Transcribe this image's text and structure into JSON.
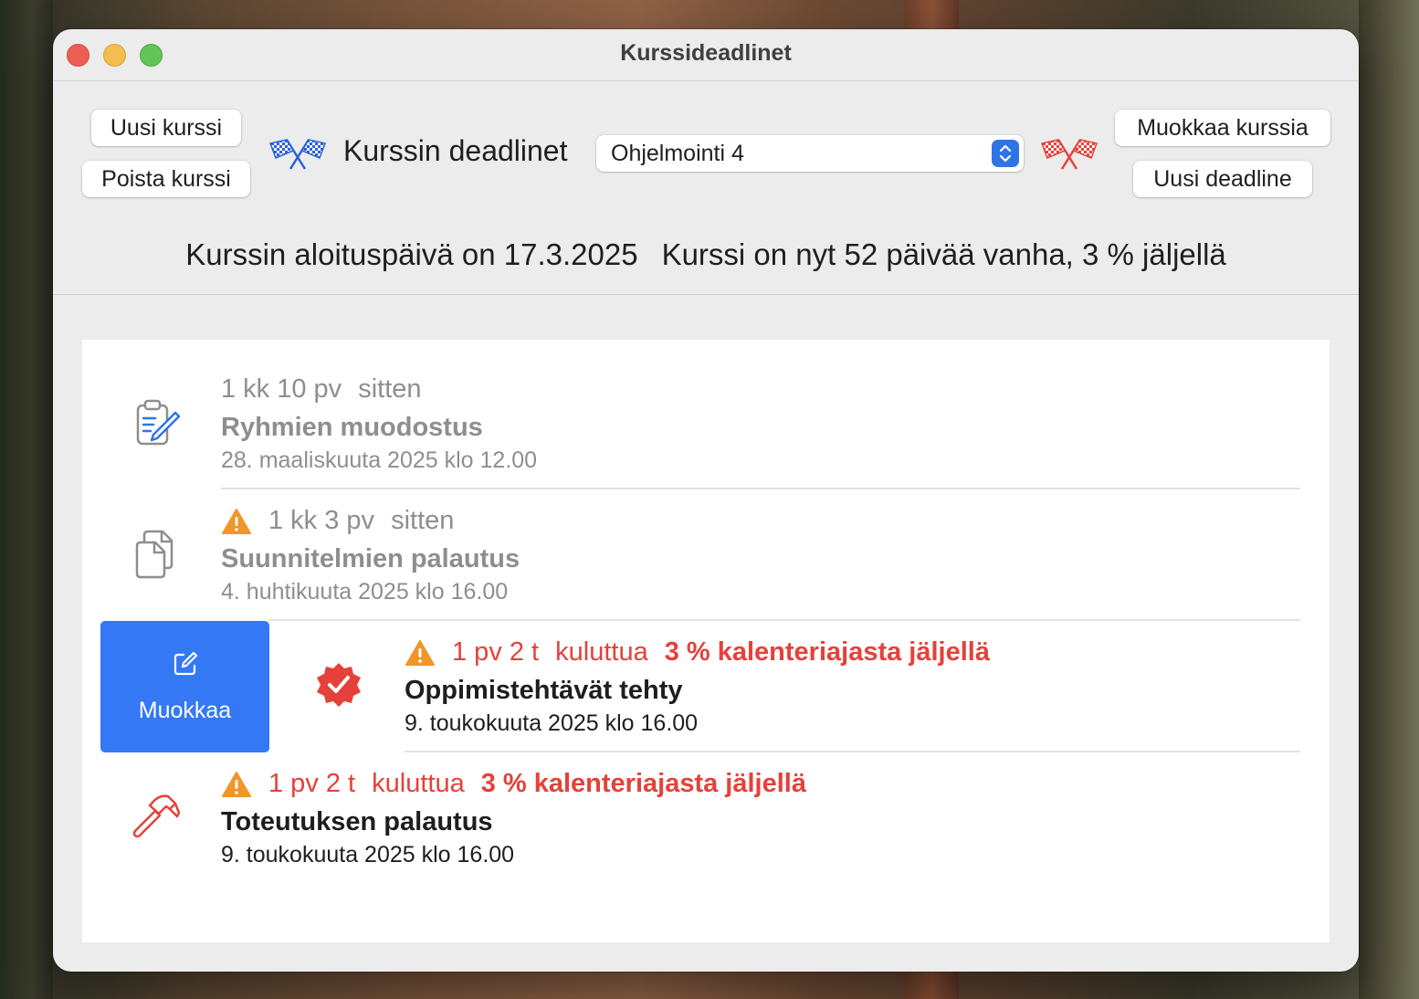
{
  "window": {
    "title": "Kurssideadlinet"
  },
  "toolbar": {
    "new_course": "Uusi kurssi",
    "delete_course": "Poista kurssi",
    "edit_course": "Muokkaa kurssia",
    "new_deadline": "Uusi deadline",
    "heading": "Kurssin deadlinet",
    "course_select": {
      "selected": "Ohjelmointi 4"
    }
  },
  "course_info": {
    "start": "Kurssin aloituspäivä on 17.3.2025",
    "age": "Kurssi on nyt 52 päivää vanha, 3 % jäljellä"
  },
  "deadlines": [
    {
      "icon": "clipboard-edit-icon",
      "when": "1 kk 10 pv",
      "relation": "sitten",
      "remaining": "",
      "title": "Ryhmien muodostus",
      "date": "28. maaliskuuta 2025 klo 12.00",
      "warning": false,
      "state": "past"
    },
    {
      "icon": "documents-icon",
      "when": "1 kk 3 pv",
      "relation": "sitten",
      "remaining": "",
      "title": "Suunnitelmien palautus",
      "date": "4. huhtikuuta 2025 klo 16.00",
      "warning": true,
      "state": "past"
    },
    {
      "icon": "checkmark-seal-icon",
      "when": "1 pv 2 t",
      "relation": "kuluttua",
      "remaining": "3 % kalenteriajasta jäljellä",
      "title": "Oppimistehtävät tehty",
      "date": "9. toukokuuta 2025 klo 16.00",
      "warning": true,
      "state": "upcoming"
    },
    {
      "icon": "hammer-icon",
      "when": "1 pv 2 t",
      "relation": "kuluttua",
      "remaining": "3 % kalenteriajasta jäljellä",
      "title": "Toteutuksen palautus",
      "date": "9. toukokuuta 2025 klo 16.00",
      "warning": true,
      "state": "upcoming"
    }
  ],
  "swipe_action": {
    "label": "Muokkaa",
    "icon": "square-pencil-icon"
  },
  "colors": {
    "accent": "#3478f6",
    "urgent": "#e5413a",
    "warning": "#f0962a",
    "past": "#8e8e8e"
  }
}
